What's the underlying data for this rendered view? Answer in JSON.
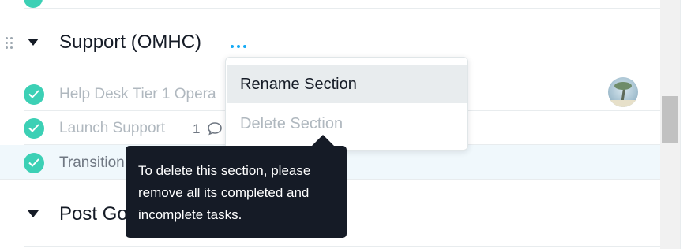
{
  "section": {
    "title": "Support (OMHC)"
  },
  "tasks": [
    {
      "name": "Help Desk Tier 1 Opera",
      "completed": true
    },
    {
      "name": "Launch Support",
      "completed": true,
      "comments": "1"
    },
    {
      "name": "Transition",
      "completed": true
    }
  ],
  "section2": {
    "title": "Post Go"
  },
  "menu": {
    "items": [
      {
        "label": "Rename Section",
        "enabled": true
      },
      {
        "label": "Delete Section",
        "enabled": false
      }
    ]
  },
  "tooltip": {
    "text": "To delete this section, please remove all its completed and incomplete tasks."
  },
  "colors": {
    "check_done": "#3cd0b5",
    "dots_accent": "#14aaf5",
    "tooltip_bg": "#151b26",
    "menu_hover": "#e8ecee"
  },
  "icons": {
    "drag": "drag-handle-icon",
    "caret": "triangle-down-icon",
    "more": "more-dots-icon",
    "check": "checkmark-icon",
    "comment": "comment-bubble-icon"
  }
}
